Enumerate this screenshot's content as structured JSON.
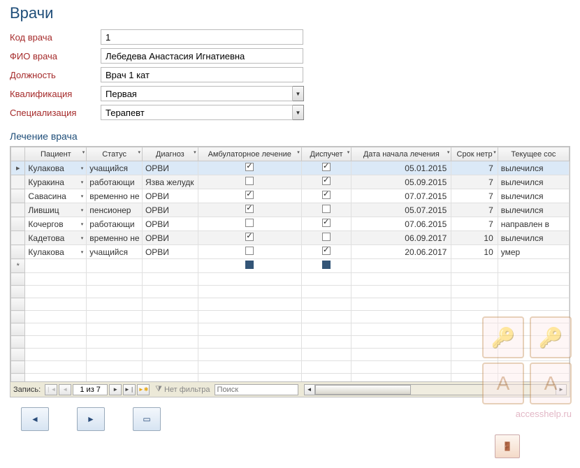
{
  "title": "Врачи",
  "fields": {
    "code": {
      "label": "Код врача",
      "value": "1"
    },
    "name": {
      "label": "ФИО врача",
      "value": "Лебедева Анастасия Игнатиевна"
    },
    "position": {
      "label": "Должность",
      "value": "Врач 1 кат"
    },
    "qualification": {
      "label": "Квалификация",
      "value": "Первая"
    },
    "specialization": {
      "label": "Специализация",
      "value": "Терапевт"
    }
  },
  "subform_title": "Лечение врача",
  "columns": {
    "patient": "Пациент",
    "status": "Статус",
    "diagnosis": "Диагноз",
    "ambulatory": "Амбулаторное лечение",
    "dispatch": "Диспучет",
    "start_date": "Дата начала лечения",
    "disability_days": "Срок нетр",
    "current_state": "Текущее сос"
  },
  "rows": [
    {
      "patient": "Кулакова",
      "status": "учащийся",
      "diagnosis": "ОРВИ",
      "ambulatory": true,
      "dispatch": true,
      "start_date": "05.01.2015",
      "disability_days": "7",
      "current_state": "вылечился",
      "selected": true
    },
    {
      "patient": "Куракина",
      "status": "работающи",
      "diagnosis": "Язва желудк",
      "ambulatory": false,
      "dispatch": true,
      "start_date": "05.09.2015",
      "disability_days": "7",
      "current_state": "вылечился"
    },
    {
      "patient": "Савасина",
      "status": "временно не",
      "diagnosis": "ОРВИ",
      "ambulatory": true,
      "dispatch": true,
      "start_date": "07.07.2015",
      "disability_days": "7",
      "current_state": "вылечился"
    },
    {
      "patient": "Лившиц",
      "status": "пенсионер",
      "diagnosis": "ОРВИ",
      "ambulatory": true,
      "dispatch": false,
      "start_date": "05.07.2015",
      "disability_days": "7",
      "current_state": "вылечился"
    },
    {
      "patient": "Кочергов",
      "status": "работающи",
      "diagnosis": "ОРВИ",
      "ambulatory": false,
      "dispatch": true,
      "start_date": "07.06.2015",
      "disability_days": "7",
      "current_state": "направлен в"
    },
    {
      "patient": "Кадетова",
      "status": "временно не",
      "diagnosis": "ОРВИ",
      "ambulatory": true,
      "dispatch": false,
      "start_date": "06.09.2017",
      "disability_days": "10",
      "current_state": "вылечился"
    },
    {
      "patient": "Кулакова",
      "status": "учащийся",
      "diagnosis": "ОРВИ",
      "ambulatory": false,
      "dispatch": true,
      "start_date": "20.06.2017",
      "disability_days": "10",
      "current_state": "умер"
    }
  ],
  "nav": {
    "label": "Запись:",
    "position": "1 из 7",
    "filter_label": "Нет фильтра",
    "search_label": "Поиск"
  },
  "watermark": "accesshelp.ru"
}
